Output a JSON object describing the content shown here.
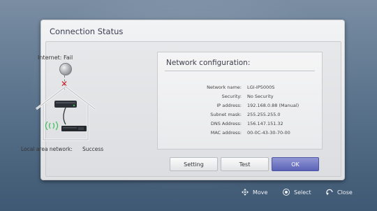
{
  "dialog": {
    "title": "Connection Status",
    "internet_label": "Internet: Fail",
    "local_network_label": "Local area network:",
    "local_network_status": "Success"
  },
  "network_config": {
    "title": "Network configuration:",
    "rows": [
      {
        "key": "Network name:",
        "value": "LGI-IP5000S"
      },
      {
        "key": "Security:",
        "value": "No Security"
      },
      {
        "key": "IP address:",
        "value": "192.168.0.88 (Manual)"
      },
      {
        "key": "Subnet mask:",
        "value": "255.255.255.0"
      },
      {
        "key": "DNS Address:",
        "value": "156.147.151.32"
      },
      {
        "key": "MAC address:",
        "value": "00-0C-43-30-70-00"
      }
    ]
  },
  "buttons": {
    "setting": "Setting",
    "test": "Test",
    "ok": "OK"
  },
  "hints": {
    "move": "Move",
    "select": "Select",
    "close": "Close"
  },
  "icons": {
    "globe": "globe-icon",
    "fail": "fail-x-icon",
    "house": "house-network-icon",
    "move": "dpad-move-icon",
    "select": "ok-select-icon",
    "close": "back-return-icon"
  },
  "colors": {
    "accent_ok": "#5b63b7",
    "fail": "#d2212a",
    "background": "#5f7890"
  }
}
